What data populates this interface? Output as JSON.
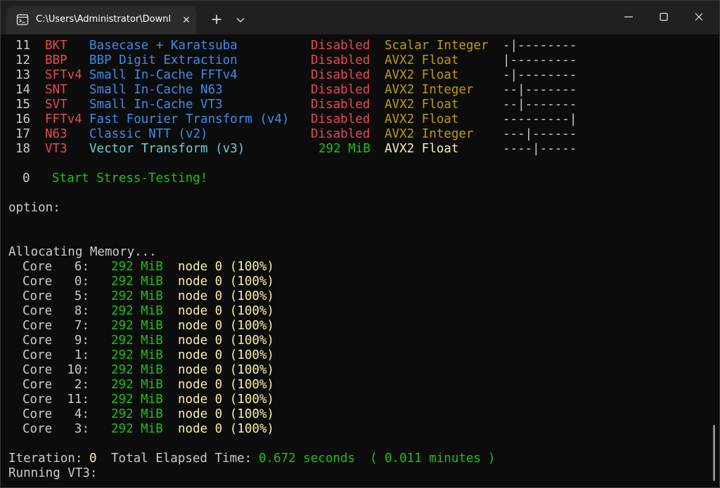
{
  "window": {
    "tab_title": "C:\\Users\\Administrator\\Downl",
    "close_glyph": "✕",
    "new_tab_glyph": "+"
  },
  "tests": [
    {
      "num": "11",
      "code": "BKT",
      "name": "Basecase + Karatsuba",
      "status": "Disabled",
      "type": "Scalar Integer",
      "bar": "-|--------"
    },
    {
      "num": "12",
      "code": "BBP",
      "name": "BBP Digit Extraction",
      "status": "Disabled",
      "type": "AVX2 Float",
      "bar": "|---------"
    },
    {
      "num": "13",
      "code": "SFTv4",
      "name": "Small In-Cache FFTv4",
      "status": "Disabled",
      "type": "AVX2 Float",
      "bar": "-|--------"
    },
    {
      "num": "14",
      "code": "SNT",
      "name": "Small In-Cache N63",
      "status": "Disabled",
      "type": "AVX2 Integer",
      "bar": "--|-------"
    },
    {
      "num": "15",
      "code": "SVT",
      "name": "Small In-Cache VT3",
      "status": "Disabled",
      "type": "AVX2 Float",
      "bar": "--|-------"
    },
    {
      "num": "16",
      "code": "FFTv4",
      "name": "Fast Fourier Transform (v4)",
      "status": "Disabled",
      "type": "AVX2 Float",
      "bar": "---------|"
    },
    {
      "num": "17",
      "code": "N63",
      "name": "Classic NTT (v2)",
      "status": "Disabled",
      "type": "AVX2 Integer",
      "bar": "---|------"
    },
    {
      "num": "18",
      "code": "VT3",
      "name": "Vector Transform (v3)",
      "status": "292 MiB",
      "type": "AVX2 Float",
      "bar": "----|-----"
    }
  ],
  "start": {
    "num": "0",
    "label": "Start Stress-Testing!"
  },
  "option_prompt": "option:",
  "allocating_label": "Allocating Memory...",
  "cores": [
    {
      "label": "Core",
      "id": "6:",
      "mem": "292 MiB",
      "node": "node 0 (100%)"
    },
    {
      "label": "Core",
      "id": "0:",
      "mem": "292 MiB",
      "node": "node 0 (100%)"
    },
    {
      "label": "Core",
      "id": "5:",
      "mem": "292 MiB",
      "node": "node 0 (100%)"
    },
    {
      "label": "Core",
      "id": "8:",
      "mem": "292 MiB",
      "node": "node 0 (100%)"
    },
    {
      "label": "Core",
      "id": "7:",
      "mem": "292 MiB",
      "node": "node 0 (100%)"
    },
    {
      "label": "Core",
      "id": "9:",
      "mem": "292 MiB",
      "node": "node 0 (100%)"
    },
    {
      "label": "Core",
      "id": "1:",
      "mem": "292 MiB",
      "node": "node 0 (100%)"
    },
    {
      "label": "Core",
      "id": "10:",
      "mem": "292 MiB",
      "node": "node 0 (100%)"
    },
    {
      "label": "Core",
      "id": "2:",
      "mem": "292 MiB",
      "node": "node 0 (100%)"
    },
    {
      "label": "Core",
      "id": "11:",
      "mem": "292 MiB",
      "node": "node 0 (100%)"
    },
    {
      "label": "Core",
      "id": "4:",
      "mem": "292 MiB",
      "node": "node 0 (100%)"
    },
    {
      "label": "Core",
      "id": "3:",
      "mem": "292 MiB",
      "node": "node 0 (100%)"
    }
  ],
  "iteration": {
    "label": "Iteration:",
    "value": "0",
    "elapsed_label": "Total Elapsed Time:",
    "seconds": "0.672 seconds",
    "minutes_open": "(",
    "minutes": "0.011 minutes",
    "minutes_close": ")"
  },
  "running": "Running VT3:"
}
